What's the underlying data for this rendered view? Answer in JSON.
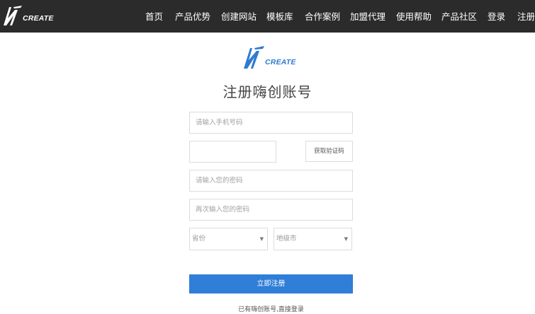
{
  "header": {
    "brand_text": "CREATE",
    "nav": [
      {
        "label": "首页"
      },
      {
        "label": "产品优势"
      },
      {
        "label": "创建网站"
      },
      {
        "label": "模板库"
      },
      {
        "label": "合作案例"
      },
      {
        "label": "加盟代理"
      },
      {
        "label": "使用帮助"
      },
      {
        "label": "产品社区"
      },
      {
        "label": "登录"
      },
      {
        "label": "注册"
      }
    ]
  },
  "logo": {
    "text": "CREATE"
  },
  "form": {
    "title": "注册嗨创账号",
    "phone_placeholder": "请输入手机号码",
    "code_value": "",
    "get_code_label": "获取验证码",
    "password_placeholder": "请输入您的密码",
    "password_confirm_placeholder": "再次输入您的密码",
    "province_label": "省份",
    "city_label": "地级市",
    "submit_label": "立即注册",
    "login_link": "已有嗨创账号,直接登录"
  },
  "colors": {
    "topbar_bg": "#2b2b2b",
    "accent": "#2f7ed8",
    "logo_blue": "#2e7ad1"
  }
}
